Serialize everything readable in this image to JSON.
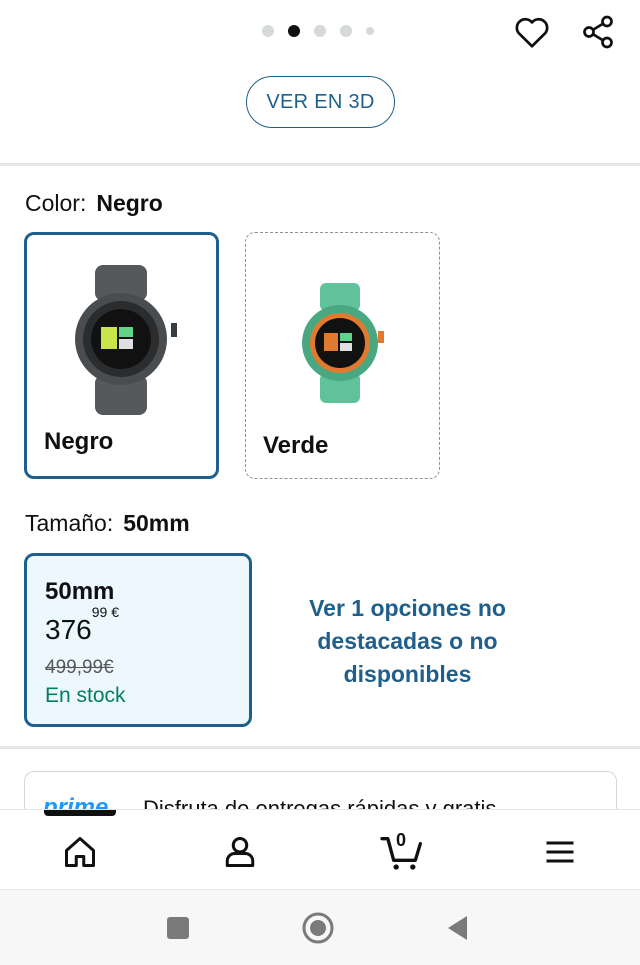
{
  "image_carousel": {
    "page_count": 5,
    "active_page": 2
  },
  "actions": {
    "wishlist_icon": "heart-icon",
    "share_icon": "share-icon"
  },
  "view_3d": {
    "label": "VER EN 3D"
  },
  "color_selector": {
    "label": "Color:",
    "selected_value": "Negro",
    "options": [
      {
        "name": "Negro",
        "selected": true,
        "watch_color": "#6b6f72"
      },
      {
        "name": "Verde",
        "selected": false,
        "watch_color": "#5fc29a"
      }
    ]
  },
  "size_selector": {
    "label": "Tamaño:",
    "selected_value": "50mm",
    "option": {
      "name": "50mm",
      "price_whole": "376",
      "price_fraction": "99",
      "currency": "€",
      "list_price": "499,99€",
      "availability": "En stock"
    },
    "more_options_link": "Ver 1 opciones no destacadas o no disponibles"
  },
  "prime_banner": {
    "logo": "prime",
    "text": "Disfruta de entregas rápidas y gratis"
  },
  "bottom_nav": {
    "items": [
      "home-icon",
      "account-icon",
      "cart-icon",
      "menu-icon"
    ],
    "cart_count": "0",
    "active_item": "home-icon"
  },
  "colors": {
    "link_blue": "#1f5f8b",
    "stock_green": "#067d62",
    "selected_bg": "#edf8fe",
    "prime_blue": "#1a98ff"
  }
}
